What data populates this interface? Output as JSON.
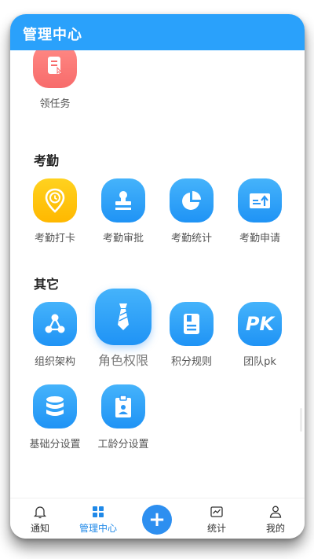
{
  "header": {
    "title": "管理中心"
  },
  "top_item": {
    "label": "领任务",
    "icon": "task-icon"
  },
  "sections": [
    {
      "title": "考勤",
      "items": [
        {
          "label": "考勤打卡",
          "icon": "location-pin-icon"
        },
        {
          "label": "考勤审批",
          "icon": "stamp-icon"
        },
        {
          "label": "考勤统计",
          "icon": "pie-chart-icon"
        },
        {
          "label": "考勤申请",
          "icon": "upload-card-icon"
        }
      ]
    },
    {
      "title": "其它",
      "items": [
        {
          "label": "组织架构",
          "icon": "org-chart-icon"
        },
        {
          "label": "角色权限",
          "icon": "tie-icon"
        },
        {
          "label": "积分规则",
          "icon": "notebook-icon"
        },
        {
          "label": "团队pk",
          "icon": "pk-icon",
          "icon_text": "PK"
        },
        {
          "label": "基础分设置",
          "icon": "database-icon"
        },
        {
          "label": "工龄分设置",
          "icon": "badge-icon"
        }
      ]
    }
  ],
  "tabbar": {
    "tabs": [
      {
        "label": "通知",
        "icon": "bell-icon"
      },
      {
        "label": "管理中心",
        "icon": "grid-icon"
      },
      {
        "label": "统计",
        "icon": "chart-icon"
      },
      {
        "label": "我的",
        "icon": "user-icon"
      }
    ],
    "center_button": "+",
    "active_tab": "管理中心"
  },
  "colors": {
    "primary": "#2aa1fb",
    "active_tab": "#2089e8",
    "yellow": "#ffc107",
    "red": "#f76b6b"
  }
}
